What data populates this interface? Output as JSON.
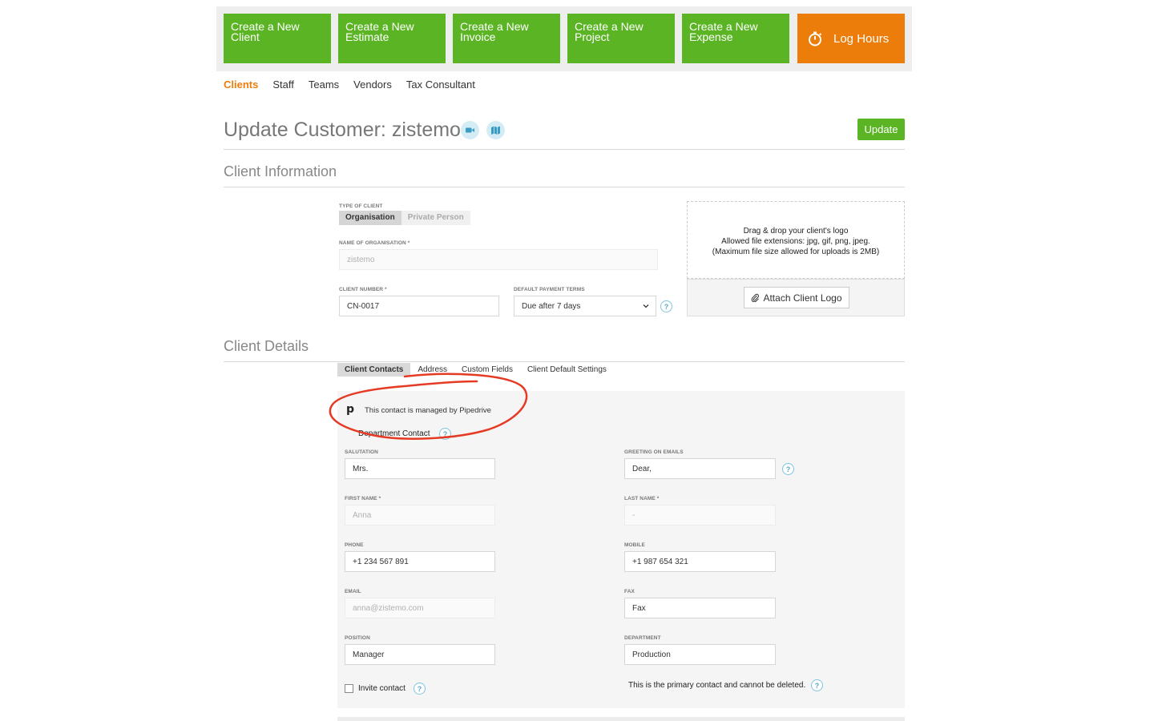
{
  "quick_actions": [
    {
      "label": "Create a New Client"
    },
    {
      "label": "Create a New Estimate"
    },
    {
      "label": "Create a New Invoice"
    },
    {
      "label": "Create a New Project"
    },
    {
      "label": "Create a New Expense"
    },
    {
      "label": "Log Hours"
    }
  ],
  "colors": {
    "accent_green": "#5ab423",
    "accent_orange": "#ed7d0a",
    "help_blue": "#5aa8c8",
    "annotation_red": "#e53a24"
  },
  "subnav": {
    "items": [
      "Clients",
      "Staff",
      "Teams",
      "Vendors",
      "Tax Consultant"
    ],
    "active": "Clients"
  },
  "page": {
    "title": "Update Customer: zistemo",
    "update_label": "Update",
    "icons": [
      "video-icon",
      "map-icon"
    ]
  },
  "client_information": {
    "heading": "Client Information",
    "type_label": "TYPE OF CLIENT",
    "type_options": [
      "Organisation",
      "Private Person"
    ],
    "type_selected": "Organisation",
    "org_name_label": "NAME OF ORGANISATION *",
    "org_name_value": "zistemo",
    "client_number_label": "CLIENT NUMBER *",
    "client_number_value": "CN-0017",
    "payment_terms_label": "DEFAULT PAYMENT TERMS",
    "payment_terms_value": "Due after 7 days",
    "logo_drop_line1": "Drag & drop your client's logo",
    "logo_drop_line2": "Allowed file extensions: jpg, gif, png, jpeg.",
    "logo_drop_line3": "(Maximum file size allowed for uploads is 2MB)",
    "attach_label": "Attach Client Logo"
  },
  "client_details": {
    "heading": "Client Details",
    "tabs": [
      "Client Contacts",
      "Address",
      "Custom Fields",
      "Client Default Settings"
    ],
    "active_tab": "Client Contacts",
    "pipedrive_logo": "p",
    "pipedrive_notice": "This contact is managed by Pipedrive",
    "department_contact_label": "Department Contact",
    "salutation_label": "SALUTATION",
    "salutation_value": "Mrs.",
    "greeting_label": "GREETING ON EMAILS",
    "greeting_value": "Dear,",
    "first_name_label": "FIRST NAME *",
    "first_name_value": "Anna",
    "last_name_label": "LAST NAME *",
    "last_name_value": "-",
    "phone_label": "PHONE",
    "phone_value": "+1 234 567 891",
    "mobile_label": "MOBILE",
    "mobile_value": "+1 987 654 321",
    "email_label": "EMAIL",
    "email_value": "anna@zistemo.com",
    "fax_label": "FAX",
    "fax_placeholder": "Fax",
    "position_label": "POSITION",
    "position_value": "Manager",
    "department_label": "DEPARTMENT",
    "department_value": "Production",
    "invite_label": "Invite contact",
    "primary_note": "This is the primary contact and cannot be deleted."
  }
}
